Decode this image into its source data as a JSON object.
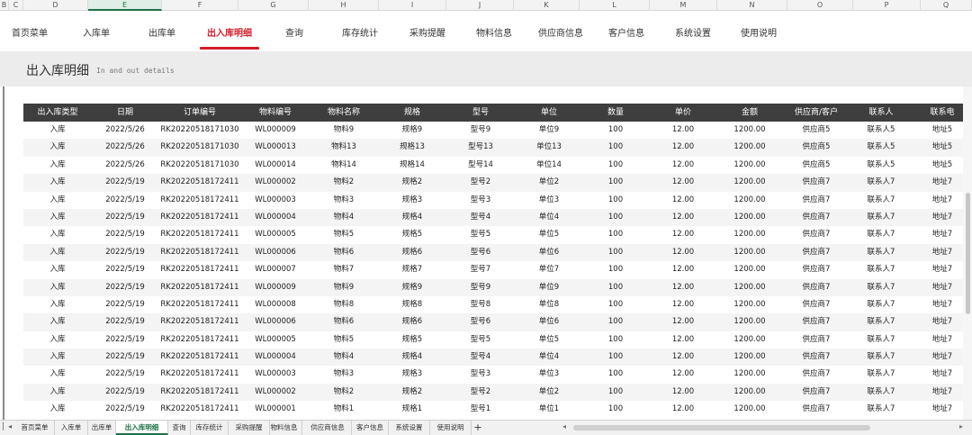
{
  "column_letters": [
    "B",
    "C",
    "D",
    "E",
    "F",
    "G",
    "H",
    "I",
    "J",
    "K",
    "L",
    "M",
    "N",
    "O",
    "P",
    "Q"
  ],
  "selected_column": "E",
  "nav": {
    "items": [
      "首页菜单",
      "入库单",
      "出库单",
      "出入库明细",
      "查询",
      "库存统计",
      "采购提醒",
      "物料信息",
      "供应商信息",
      "客户信息",
      "系统设置",
      "使用说明"
    ],
    "active": "出入库明细"
  },
  "title": {
    "main": "出入库明细",
    "sub": "In and out details"
  },
  "table": {
    "headers": [
      "出入库类型",
      "日期",
      "订单编号",
      "物料编号",
      "物料名称",
      "规格",
      "型号",
      "单位",
      "数量",
      "单价",
      "金额",
      "供应商/客户",
      "联系人",
      "联系电"
    ],
    "rows": [
      [
        "入库",
        "2022/5/26",
        "RK20220518171030",
        "WL000009",
        "物料9",
        "规格9",
        "型号9",
        "单位9",
        "100",
        "12.00",
        "1200.00",
        "供应商5",
        "联系人5",
        "地址5"
      ],
      [
        "入库",
        "2022/5/26",
        "RK20220518171030",
        "WL000013",
        "物料13",
        "规格13",
        "型号13",
        "单位13",
        "100",
        "12.00",
        "1200.00",
        "供应商5",
        "联系人5",
        "地址5"
      ],
      [
        "入库",
        "2022/5/26",
        "RK20220518171030",
        "WL000014",
        "物料14",
        "规格14",
        "型号14",
        "单位14",
        "100",
        "12.00",
        "1200.00",
        "供应商5",
        "联系人5",
        "地址5"
      ],
      [
        "入库",
        "2022/5/19",
        "RK20220518172411",
        "WL000002",
        "物料2",
        "规格2",
        "型号2",
        "单位2",
        "100",
        "12.00",
        "1200.00",
        "供应商7",
        "联系人7",
        "地址7"
      ],
      [
        "入库",
        "2022/5/19",
        "RK20220518172411",
        "WL000003",
        "物料3",
        "规格3",
        "型号3",
        "单位3",
        "100",
        "12.00",
        "1200.00",
        "供应商7",
        "联系人7",
        "地址7"
      ],
      [
        "入库",
        "2022/5/19",
        "RK20220518172411",
        "WL000004",
        "物料4",
        "规格4",
        "型号4",
        "单位4",
        "100",
        "12.00",
        "1200.00",
        "供应商7",
        "联系人7",
        "地址7"
      ],
      [
        "入库",
        "2022/5/19",
        "RK20220518172411",
        "WL000005",
        "物料5",
        "规格5",
        "型号5",
        "单位5",
        "100",
        "12.00",
        "1200.00",
        "供应商7",
        "联系人7",
        "地址7"
      ],
      [
        "入库",
        "2022/5/19",
        "RK20220518172411",
        "WL000006",
        "物料6",
        "规格6",
        "型号6",
        "单位6",
        "100",
        "12.00",
        "1200.00",
        "供应商7",
        "联系人7",
        "地址7"
      ],
      [
        "入库",
        "2022/5/19",
        "RK20220518172411",
        "WL000007",
        "物料7",
        "规格7",
        "型号7",
        "单位7",
        "100",
        "12.00",
        "1200.00",
        "供应商7",
        "联系人7",
        "地址7"
      ],
      [
        "入库",
        "2022/5/19",
        "RK20220518172411",
        "WL000009",
        "物料9",
        "规格9",
        "型号9",
        "单位9",
        "100",
        "12.00",
        "1200.00",
        "供应商7",
        "联系人7",
        "地址7"
      ],
      [
        "入库",
        "2022/5/19",
        "RK20220518172411",
        "WL000008",
        "物料8",
        "规格8",
        "型号8",
        "单位8",
        "100",
        "12.00",
        "1200.00",
        "供应商7",
        "联系人7",
        "地址7"
      ],
      [
        "入库",
        "2022/5/19",
        "RK20220518172411",
        "WL000006",
        "物料6",
        "规格6",
        "型号6",
        "单位6",
        "100",
        "12.00",
        "1200.00",
        "供应商7",
        "联系人7",
        "地址7"
      ],
      [
        "入库",
        "2022/5/19",
        "RK20220518172411",
        "WL000005",
        "物料5",
        "规格5",
        "型号5",
        "单位5",
        "100",
        "12.00",
        "1200.00",
        "供应商7",
        "联系人7",
        "地址7"
      ],
      [
        "入库",
        "2022/5/19",
        "RK20220518172411",
        "WL000004",
        "物料4",
        "规格4",
        "型号4",
        "单位4",
        "100",
        "12.00",
        "1200.00",
        "供应商7",
        "联系人7",
        "地址7"
      ],
      [
        "入库",
        "2022/5/19",
        "RK20220518172411",
        "WL000003",
        "物料3",
        "规格3",
        "型号3",
        "单位3",
        "100",
        "12.00",
        "1200.00",
        "供应商7",
        "联系人7",
        "地址7"
      ],
      [
        "入库",
        "2022/5/19",
        "RK20220518172411",
        "WL000002",
        "物料2",
        "规格2",
        "型号2",
        "单位2",
        "100",
        "12.00",
        "1200.00",
        "供应商7",
        "联系人7",
        "地址7"
      ],
      [
        "入库",
        "2022/5/19",
        "RK20220518172411",
        "WL000001",
        "物料1",
        "规格1",
        "型号1",
        "单位1",
        "100",
        "12.00",
        "1200.00",
        "供应商7",
        "联系人7",
        "地址7"
      ]
    ]
  },
  "sheet_tabs": {
    "items": [
      "首页菜单",
      "入库单",
      "出库单",
      "出入库明细",
      "查询",
      "库存统计",
      "采购提醒",
      "物料信息",
      "供应商信息",
      "客户信息",
      "系统设置",
      "使用说明"
    ],
    "active": "出入库明细",
    "add_label": "+"
  },
  "colors": {
    "accent": "#d41c2a",
    "header_bg": "#3e3e3e",
    "sheet_active": "#1e7145"
  }
}
